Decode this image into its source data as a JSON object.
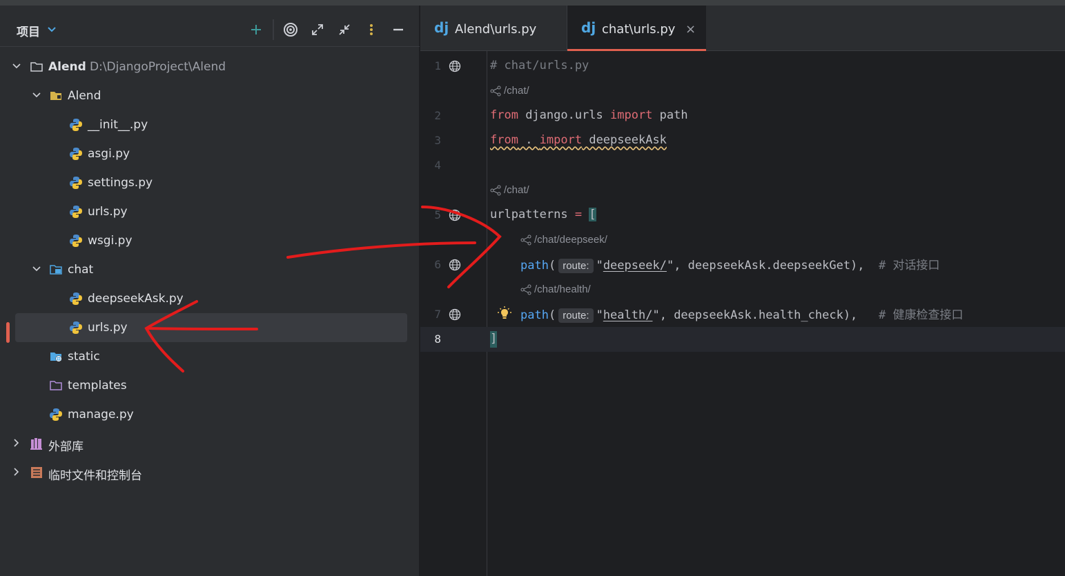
{
  "project_panel": {
    "title": "项目",
    "tree": [
      {
        "label": "Alend",
        "path": "D:\\DjangoProject\\Alend",
        "type": "root-folder",
        "expanded": true
      },
      {
        "label": "Alend",
        "type": "package",
        "expanded": true
      },
      {
        "label": "__init__.py",
        "type": "python-file"
      },
      {
        "label": "asgi.py",
        "type": "python-file"
      },
      {
        "label": "settings.py",
        "type": "python-file"
      },
      {
        "label": "urls.py",
        "type": "python-file"
      },
      {
        "label": "wsgi.py",
        "type": "python-file"
      },
      {
        "label": "chat",
        "type": "app-folder",
        "expanded": true
      },
      {
        "label": "deepseekAsk.py",
        "type": "python-file"
      },
      {
        "label": "urls.py",
        "type": "python-file",
        "selected": true
      },
      {
        "label": "static",
        "type": "web-folder"
      },
      {
        "label": "templates",
        "type": "template-folder"
      },
      {
        "label": "manage.py",
        "type": "python-file"
      },
      {
        "label": "外部库",
        "type": "library",
        "expanded": false
      },
      {
        "label": "临时文件和控制台",
        "type": "scratches",
        "expanded": false
      }
    ]
  },
  "editor": {
    "tabs": [
      {
        "icon": "dj",
        "label": "Alend\\urls.py",
        "active": false
      },
      {
        "icon": "dj",
        "label": "chat\\urls.py",
        "active": true,
        "close": "×"
      }
    ],
    "endpoints": {
      "e1": "/chat/",
      "e2": "/chat/",
      "e3": "/chat/deepseek/",
      "e4": "/chat/health/"
    },
    "lines": {
      "n1": "1",
      "n2": "2",
      "n3": "3",
      "n4": "4",
      "n5": "5",
      "n6": "6",
      "n7": "7",
      "n8": "8",
      "l1": "# chat/urls.py",
      "l2_kw": "from",
      "l2_mod": " django.urls ",
      "l2_kw2": "import",
      "l2_name": " path",
      "l3_kw": "from",
      "l3_mod": " . ",
      "l3_kw2": "import",
      "l3_name": " deepseekAsk",
      "l5_name": "urlpatterns",
      "l5_op": " = ",
      "l5_br": "[",
      "l6_fn": "path",
      "l6_p": "(",
      "l6_hint": "route:",
      "l6_q1": "\"",
      "l6_str": "deepseek/",
      "l6_q2": "\"",
      "l6_rest": ", deepseekAsk.deepseekGet),  ",
      "l6_cmt": "# 对话接口",
      "l7_fn": "path",
      "l7_p": "(",
      "l7_hint": "route:",
      "l7_q1": "\"",
      "l7_str": "health/",
      "l7_q2": "\"",
      "l7_rest": ", deepseekAsk.health_check),   ",
      "l7_cmt": "# 健康检查接口",
      "l8": "]"
    }
  },
  "colors": {
    "accent": "#e0604f",
    "annotation": "#e31c1c",
    "django": "#4fa7e3"
  }
}
